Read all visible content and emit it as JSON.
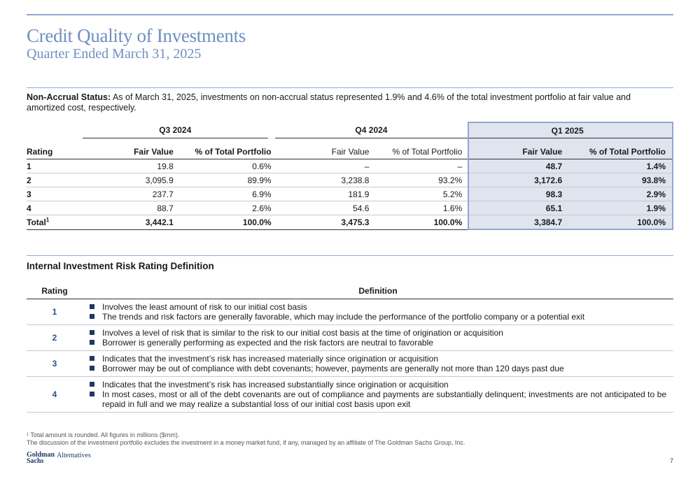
{
  "title": "Credit Quality of Investments",
  "subtitle": "Quarter Ended March 31, 2025",
  "note": {
    "label": "Non-Accrual Status:",
    "text": "As of March 31, 2025, investments on non-accrual status represented 1.9% and 4.6% of the total investment portfolio at fair value and amortized cost, respectively."
  },
  "table1": {
    "groups": [
      "Q3 2024",
      "Q4 2024",
      "Q1 2025"
    ],
    "headers": {
      "rating": "Rating",
      "q3_fv": "Fair Value",
      "q3_pct": "% of Total Portfolio",
      "q4_fv": "Fair Value",
      "q4_pct": "% of Total Portfolio",
      "q1_fv": "Fair Value",
      "q1_pct": "% of Total Portfolio"
    },
    "rows": [
      {
        "rating": "1",
        "q3_fv": "19.8",
        "q3_pct": "0.6%",
        "q4_fv": "–",
        "q4_pct": "–",
        "q1_fv": "48.7",
        "q1_pct": "1.4%"
      },
      {
        "rating": "2",
        "q3_fv": "3,095.9",
        "q3_pct": "89.9%",
        "q4_fv": "3,238.8",
        "q4_pct": "93.2%",
        "q1_fv": "3,172.6",
        "q1_pct": "93.8%"
      },
      {
        "rating": "3",
        "q3_fv": "237.7",
        "q3_pct": "6.9%",
        "q4_fv": "181.9",
        "q4_pct": "5.2%",
        "q1_fv": "98.3",
        "q1_pct": "2.9%"
      },
      {
        "rating": "4",
        "q3_fv": "88.7",
        "q3_pct": "2.6%",
        "q4_fv": "54.6",
        "q4_pct": "1.6%",
        "q1_fv": "65.1",
        "q1_pct": "1.9%"
      }
    ],
    "total": {
      "label": "Total",
      "sup": "1",
      "q3_fv": "3,442.1",
      "q3_pct": "100.0%",
      "q4_fv": "3,475.3",
      "q4_pct": "100.0%",
      "q1_fv": "3,384.7",
      "q1_pct": "100.0%"
    }
  },
  "section2": {
    "title": "Internal Investment Risk Rating Definition",
    "col_rating": "Rating",
    "col_definition": "Definition",
    "rows": [
      {
        "rating": "1",
        "bullets": [
          "Involves the least amount of risk to our initial cost basis",
          "The trends and risk factors are generally favorable, which may include the performance of the portfolio company or a potential exit"
        ]
      },
      {
        "rating": "2",
        "bullets": [
          "Involves a level of risk that is similar to the risk to our initial cost basis at the time of origination or acquisition",
          "Borrower is generally performing as expected and the risk factors are neutral to favorable"
        ]
      },
      {
        "rating": "3",
        "bullets": [
          "Indicates that the investment’s risk has increased materially since origination or acquisition",
          "Borrower may be out of compliance with debt covenants; however, payments are generally not more than 120 days past due"
        ]
      },
      {
        "rating": "4",
        "bullets": [
          "Indicates that the investment’s risk has increased substantially since origination or acquisition",
          "In most cases, most or all of the debt covenants are out of compliance and payments are substantially delinquent; investments are not anticipated to be repaid in full and we may realize a substantial loss of our initial cost basis upon exit"
        ]
      }
    ]
  },
  "footnotes": {
    "f1": "¹ Total amount is rounded. All figures in millions ($mm).",
    "f2": "The discussion of the investment portfolio excludes the investment in a money market fund, if any, managed by an affiliate of The Goldman Sachs Group, Inc."
  },
  "logo": {
    "brand": "Goldman Sachs",
    "division": "Alternatives"
  },
  "page_number": "7",
  "colors": {
    "accent": "#6f8fc1",
    "rule": "#8ea9cf",
    "highlight": "#dfe5ee",
    "navy": "#1f3864"
  }
}
